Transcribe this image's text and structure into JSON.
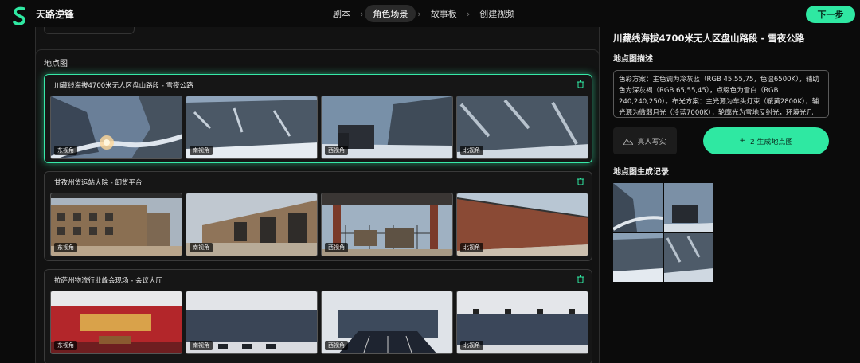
{
  "app": {
    "name": "天路逆锋"
  },
  "nav": {
    "steps": [
      "剧本",
      "角色场景",
      "故事板",
      "创建视频"
    ],
    "active": 1,
    "next_label": "下一步"
  },
  "main": {
    "panel_title": "地点图",
    "locations": [
      {
        "title": "川藏线海拔4700米无人区盘山路段 - 雪夜公路",
        "selected": true,
        "views": [
          "东视角",
          "南视角",
          "西视角",
          "北视角"
        ]
      },
      {
        "title": "甘孜州货运站大院 - 卸货平台",
        "selected": false,
        "views": [
          "东视角",
          "南视角",
          "西视角",
          "北视角"
        ]
      },
      {
        "title": "拉萨州物流行业峰会现场 - 会议大厅",
        "selected": false,
        "views": [
          "东视角",
          "南视角",
          "西视角",
          "北视角"
        ]
      }
    ]
  },
  "right": {
    "title": "川藏线海拔4700米无人区盘山路段 - 雪夜公路",
    "desc_label": "地点图描述",
    "description": "色彩方案：主色调为冷灰蓝（RGB 45,55,75，色温6500K），辅助色为深灰褐（RGB 65,55,45），点缀色为雪白（RGB 240,240,250）。布光方案：主光源为车头灯束（暖黄2800K），辅光源为微弱月光（冷蓝7000K），轮廓光为雪地反射光，环境光几",
    "style_label": "真人写实",
    "generate_label": "2  生成地点图",
    "history_label": "地点图生成记录"
  },
  "colors": {
    "accent": "#2fe8a2",
    "background": "#0b0b0b"
  },
  "icons": [
    "logo-icon",
    "chevron-right-icon",
    "trash-icon",
    "mountain-icon",
    "plus-icon"
  ]
}
